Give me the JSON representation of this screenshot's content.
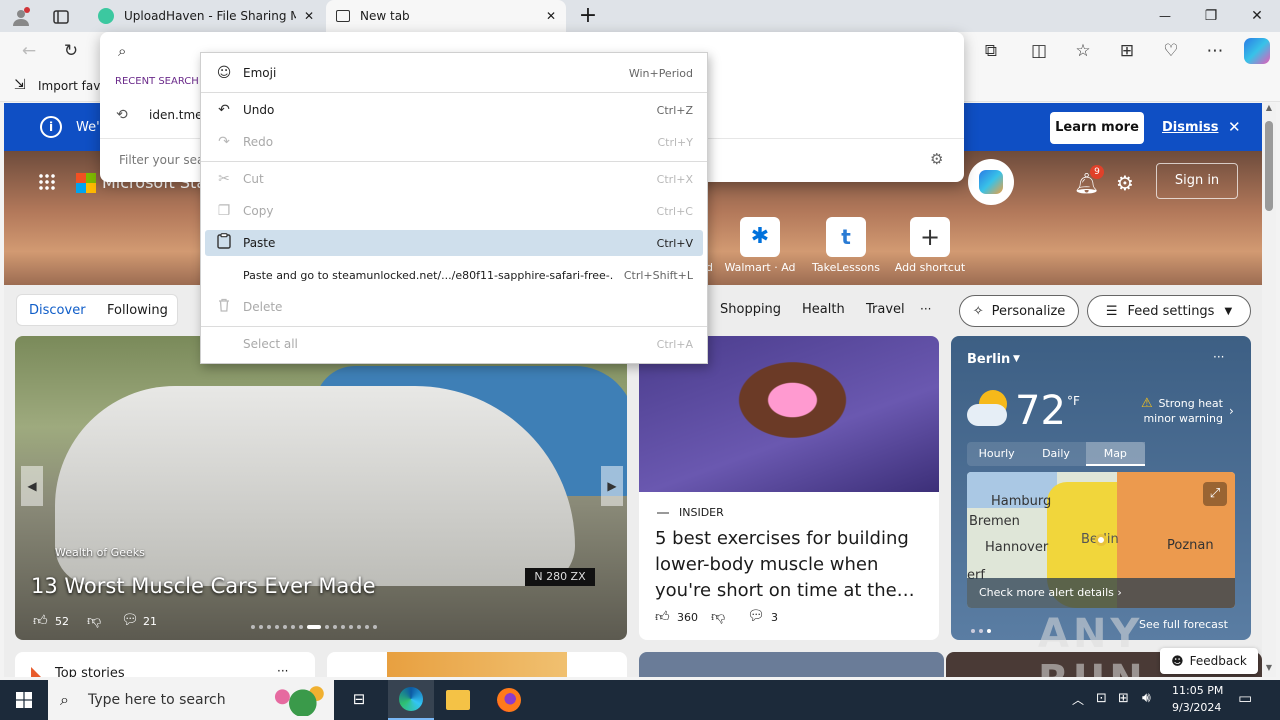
{
  "tabs": [
    {
      "title": "UploadHaven - File Sharing Made",
      "close": "✕"
    },
    {
      "title": "New tab",
      "close": "✕"
    }
  ],
  "new_tab_glyph": "+",
  "window_controls": {
    "minimize": "—",
    "maximize": "❐",
    "close": "✕"
  },
  "favorites": {
    "import_label": "Import favo"
  },
  "search_dropdown": {
    "recent_label": "RECENT SEARCH",
    "recent_item": "iden.tme",
    "filter_placeholder": "Filter your sea"
  },
  "context_menu": {
    "items": [
      {
        "label": "Emoji",
        "shortcut": "Win+Period",
        "icon": "emoji-icon",
        "glyph": "☺",
        "state": "normal"
      },
      {
        "label": "Undo",
        "shortcut": "Ctrl+Z",
        "icon": "undo-icon",
        "glyph": "↶",
        "state": "normal"
      },
      {
        "label": "Redo",
        "shortcut": "Ctrl+Y",
        "icon": "redo-icon",
        "glyph": "↷",
        "state": "disabled"
      },
      {
        "label": "Cut",
        "shortcut": "Ctrl+X",
        "icon": "cut-icon",
        "glyph": "✂",
        "state": "disabled"
      },
      {
        "label": "Copy",
        "shortcut": "Ctrl+C",
        "icon": "copy-icon",
        "glyph": "❐",
        "state": "disabled"
      },
      {
        "label": "Paste",
        "shortcut": "Ctrl+V",
        "icon": "paste-icon",
        "glyph": "📋",
        "state": "highlighted"
      },
      {
        "label": "Paste and go to steamunlocked.net/.../e80f11-sapphire-safari-free-...",
        "shortcut": "Ctrl+Shift+L",
        "icon": "",
        "glyph": "",
        "state": "normal"
      },
      {
        "label": "Delete",
        "shortcut": "",
        "icon": "delete-icon",
        "glyph": "🗑",
        "state": "disabled"
      },
      {
        "label": "Select all",
        "shortcut": "Ctrl+A",
        "icon": "",
        "glyph": "",
        "state": "disabled"
      }
    ]
  },
  "infobar": {
    "text": "We'",
    "learn_more": "Learn more",
    "dismiss": "Dismiss",
    "close": "✕"
  },
  "msn": {
    "brand": "Microsoft Star",
    "notification_count": "9",
    "sign_in": "Sign in",
    "shortcuts": [
      {
        "label": "d",
        "icon": "partial-shortcut"
      },
      {
        "label": "Walmart · Ad",
        "icon": "walmart-icon",
        "glyph": "✱"
      },
      {
        "label": "TakeLessons",
        "icon": "takelessons-icon",
        "glyph": "t"
      },
      {
        "label": "Add shortcut",
        "icon": "add-icon",
        "glyph": "+"
      }
    ],
    "feed_tabs": {
      "discover": "Discover",
      "following": "Following"
    },
    "categories": [
      "Shopping",
      "Health",
      "Travel"
    ],
    "more_glyph": "···",
    "personalize": "Personalize",
    "feed_settings": "Feed settings"
  },
  "hero_card": {
    "source": "Wealth of Geeks",
    "headline": "13 Worst Muscle Cars Ever Made",
    "likes": "52",
    "comments": "21",
    "plate": "N 280 ZX"
  },
  "article_card": {
    "source": "INSIDER",
    "headline": "5 best exercises for building lower-body muscle when you're short on time at the…",
    "likes": "360",
    "comments": "3"
  },
  "weather": {
    "city": "Berlin",
    "temp": "72",
    "unit": "°F",
    "alert": "Strong heat minor warning",
    "tabs": [
      "Hourly",
      "Daily",
      "Map"
    ],
    "active_tab": "Map",
    "map_labels": [
      "Hamburg",
      "Bremen",
      "Hannover",
      "Berlin",
      "Poznan",
      "erf"
    ],
    "alert_link": "Check more alert details",
    "forecast_link": "See full forecast"
  },
  "bottom": {
    "top_stories": "Top stories",
    "feedback": "Feedback"
  },
  "taskbar": {
    "search_placeholder": "Type here to search",
    "time": "11:05 PM",
    "date": "9/3/2024"
  },
  "watermark": "ANY RUN"
}
